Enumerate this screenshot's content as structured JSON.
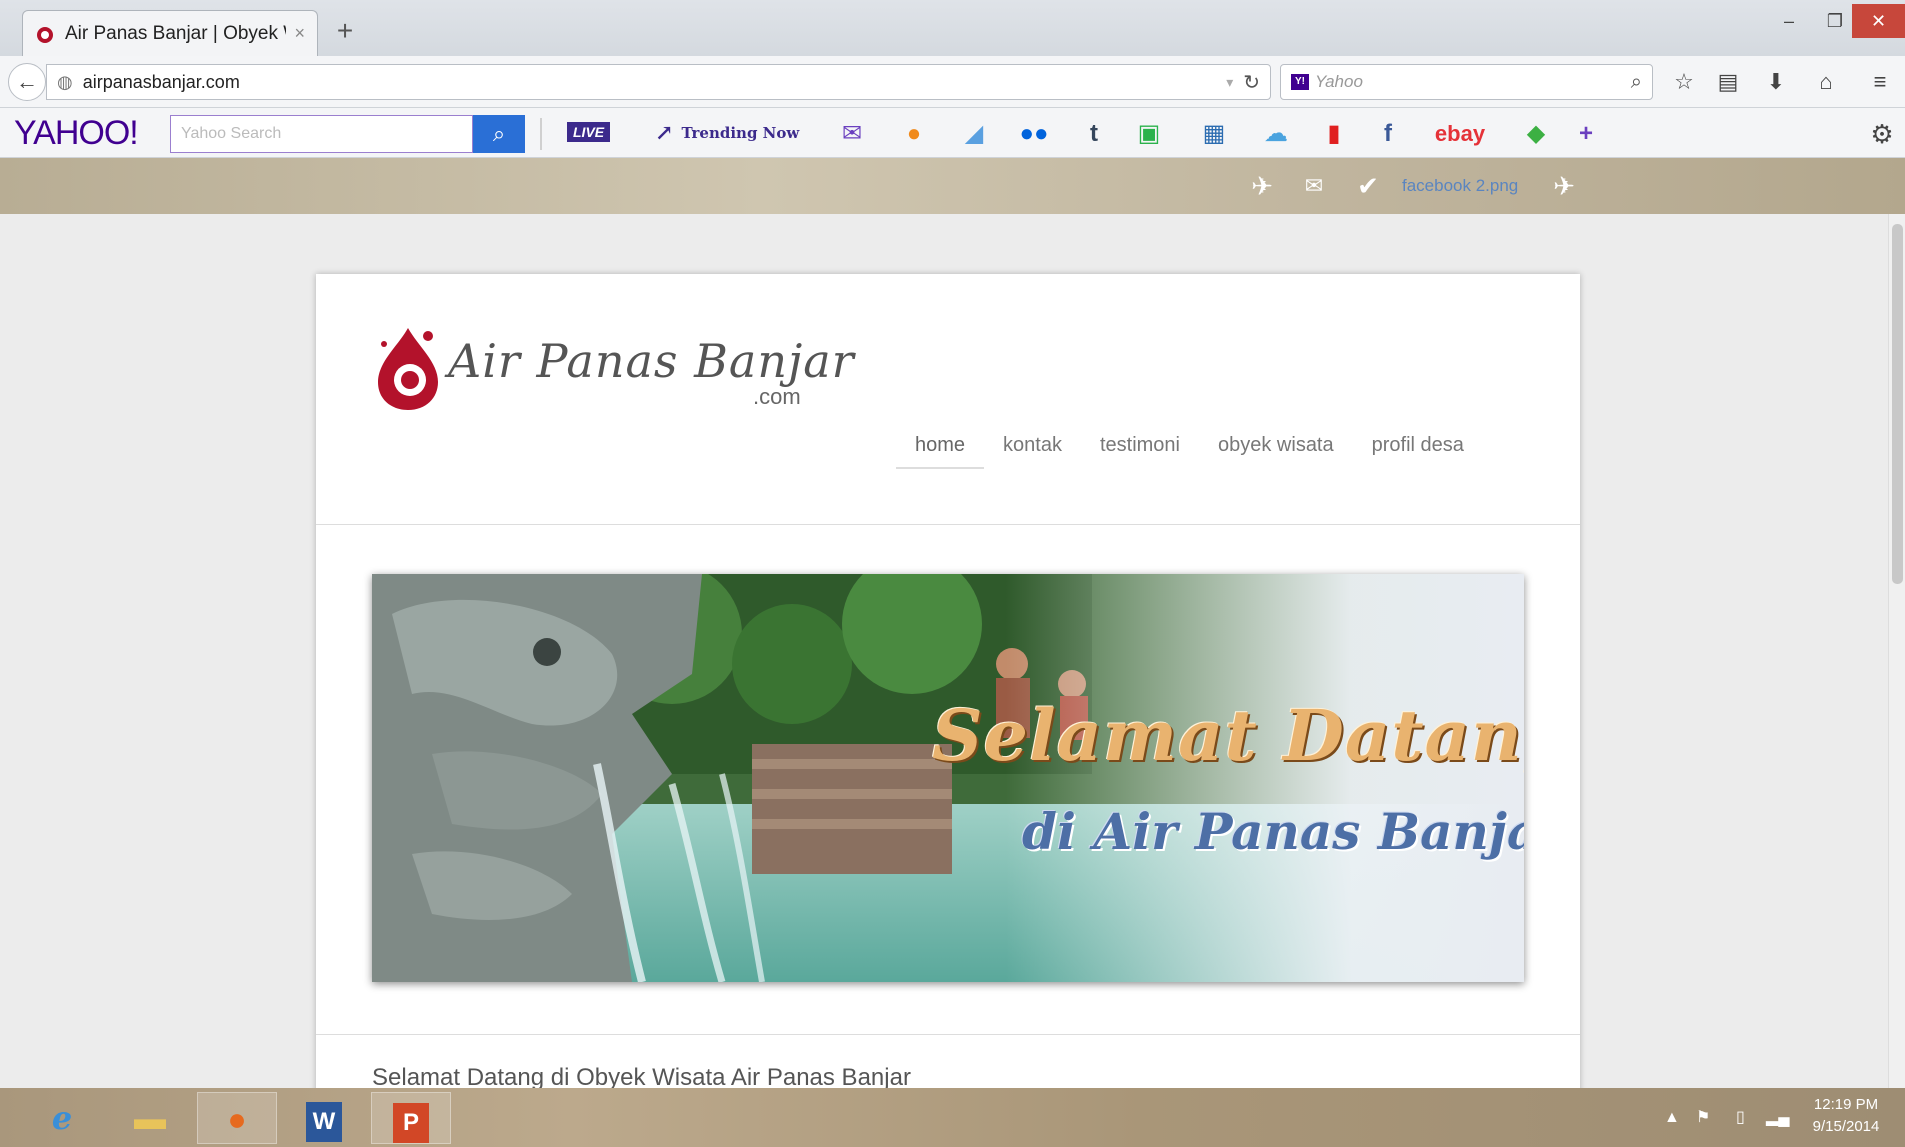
{
  "browser": {
    "tab_title": "Air Panas Banjar | Obyek W...",
    "tab_close": "×",
    "new_tab": "+",
    "url": "airpanasbanjar.com",
    "search_placeholder": "Yahoo",
    "window_min": "‒",
    "window_max": "❐",
    "window_close": "✕"
  },
  "yahoo_toolbar": {
    "logo": "YAHOO!",
    "search_placeholder": "Yahoo Search",
    "live_label": "LIVE",
    "trending_label": "Trending Now",
    "ebay_label": "ebay"
  },
  "bookmarks": {
    "facebook_item": "facebook 2.png"
  },
  "site": {
    "logo_text": "Air Panas Banjar",
    "logo_suffix": ".com",
    "menu": [
      {
        "label": "home",
        "active": true
      },
      {
        "label": "kontak"
      },
      {
        "label": "testimoni"
      },
      {
        "label": "obyek wisata"
      },
      {
        "label": "profil desa"
      }
    ],
    "banner_line1": "Selamat Datang",
    "banner_line2": "di Air Panas Banjar",
    "welcome_heading": "Selamat Datang di Obyek Wisata Air Panas Banjar"
  },
  "taskbar": {
    "clock_time": "12:19 PM",
    "clock_date": "9/15/2014",
    "word_label": "W",
    "ppt_label": "P"
  },
  "colors": {
    "yahoo_purple": "#400090",
    "search_button_blue": "#2a6fd6",
    "window_close_red": "#c7473b",
    "logo_red": "#b3122b"
  }
}
